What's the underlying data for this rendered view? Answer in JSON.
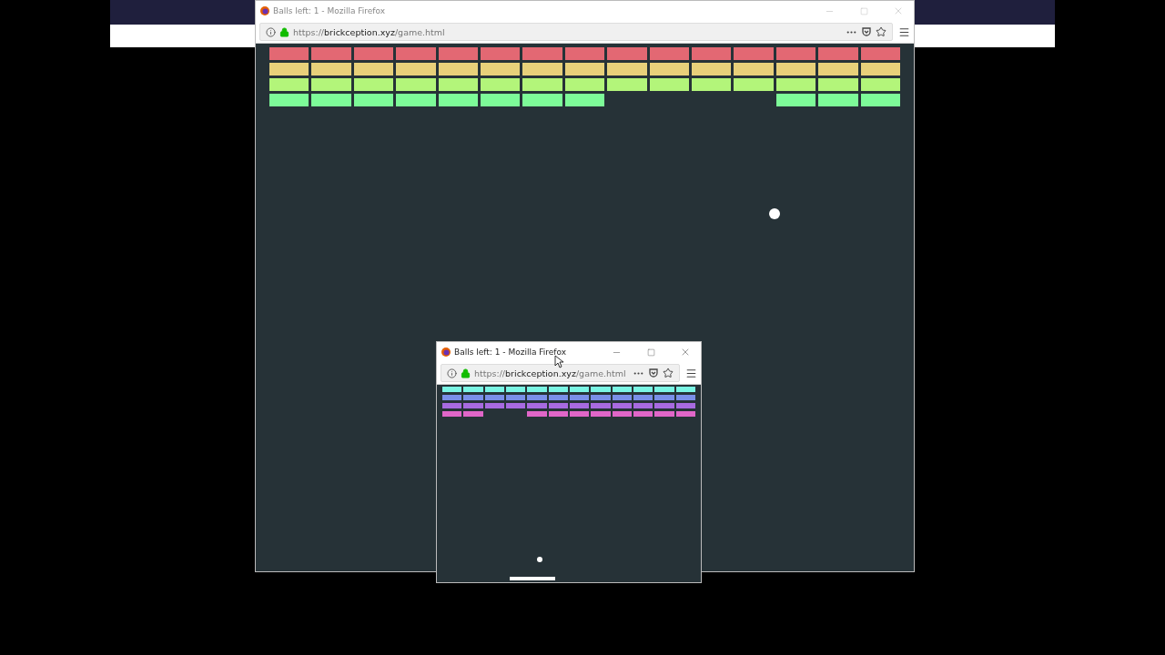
{
  "main_window": {
    "title": "Balls left: 1 - Mozilla Firefox",
    "active": false,
    "url": "https://**brickception.xyz**/game.html",
    "brick_rows": [
      {
        "color": "#e36873",
        "bricks": [
          {
            "broken": false
          },
          {
            "broken": false
          },
          {
            "broken": false
          },
          {
            "broken": false
          },
          {
            "broken": false
          },
          {
            "broken": false
          },
          {
            "broken": false
          },
          {
            "broken": false
          },
          {
            "broken": false
          },
          {
            "broken": false
          },
          {
            "broken": false
          },
          {
            "broken": false
          },
          {
            "broken": false
          },
          {
            "broken": false
          },
          {
            "broken": false
          }
        ]
      },
      {
        "color": "#e8d07a",
        "bricks": [
          {
            "broken": false
          },
          {
            "broken": false
          },
          {
            "broken": false
          },
          {
            "broken": false
          },
          {
            "broken": false
          },
          {
            "broken": false
          },
          {
            "broken": false
          },
          {
            "broken": false
          },
          {
            "broken": false
          },
          {
            "broken": false
          },
          {
            "broken": false
          },
          {
            "broken": false
          },
          {
            "broken": false
          },
          {
            "broken": false
          },
          {
            "broken": false
          }
        ]
      },
      {
        "color": "#b3f57a",
        "bricks": [
          {
            "broken": false
          },
          {
            "broken": false
          },
          {
            "broken": false
          },
          {
            "broken": false
          },
          {
            "broken": false
          },
          {
            "broken": false
          },
          {
            "broken": false
          },
          {
            "broken": false
          },
          {
            "broken": false
          },
          {
            "broken": false
          },
          {
            "broken": false
          },
          {
            "broken": false
          },
          {
            "broken": false
          },
          {
            "broken": false
          },
          {
            "broken": false
          }
        ]
      },
      {
        "color": "#7dfb98",
        "bricks": [
          {
            "broken": false
          },
          {
            "broken": false
          },
          {
            "broken": false
          },
          {
            "broken": false
          },
          {
            "broken": false
          },
          {
            "broken": false
          },
          {
            "broken": false
          },
          {
            "broken": false
          },
          {
            "broken": true
          },
          {
            "broken": true
          },
          {
            "broken": true
          },
          {
            "broken": true
          },
          {
            "broken": false
          },
          {
            "broken": false
          },
          {
            "broken": false
          }
        ]
      }
    ]
  },
  "inner_window": {
    "title": "Balls left: 1 - Mozilla Firefox",
    "active": true,
    "url": "https://**brickception.xyz**/game.html",
    "brick_rows": [
      {
        "color": "#7af5e4",
        "bricks": [
          {
            "broken": false
          },
          {
            "broken": false
          },
          {
            "broken": false
          },
          {
            "broken": false
          },
          {
            "broken": false
          },
          {
            "broken": false
          },
          {
            "broken": false
          },
          {
            "broken": false
          },
          {
            "broken": false
          },
          {
            "broken": false
          },
          {
            "broken": false
          },
          {
            "broken": false
          }
        ]
      },
      {
        "color": "#7a8fe8",
        "bricks": [
          {
            "broken": false
          },
          {
            "broken": false
          },
          {
            "broken": false
          },
          {
            "broken": false
          },
          {
            "broken": false
          },
          {
            "broken": false
          },
          {
            "broken": false
          },
          {
            "broken": false
          },
          {
            "broken": false
          },
          {
            "broken": false
          },
          {
            "broken": false
          },
          {
            "broken": false
          }
        ]
      },
      {
        "color": "#a86ae0",
        "bricks": [
          {
            "broken": false
          },
          {
            "broken": false
          },
          {
            "broken": false
          },
          {
            "broken": false
          },
          {
            "broken": false
          },
          {
            "broken": false
          },
          {
            "broken": false
          },
          {
            "broken": false
          },
          {
            "broken": false
          },
          {
            "broken": false
          },
          {
            "broken": false
          },
          {
            "broken": false
          }
        ]
      },
      {
        "color": "#e066c8",
        "bricks": [
          {
            "broken": false
          },
          {
            "broken": false
          },
          {
            "broken": true
          },
          {
            "broken": true
          },
          {
            "broken": false
          },
          {
            "broken": false
          },
          {
            "broken": false
          },
          {
            "broken": false
          },
          {
            "broken": false
          },
          {
            "broken": false
          },
          {
            "broken": false
          },
          {
            "broken": false
          }
        ]
      }
    ]
  }
}
